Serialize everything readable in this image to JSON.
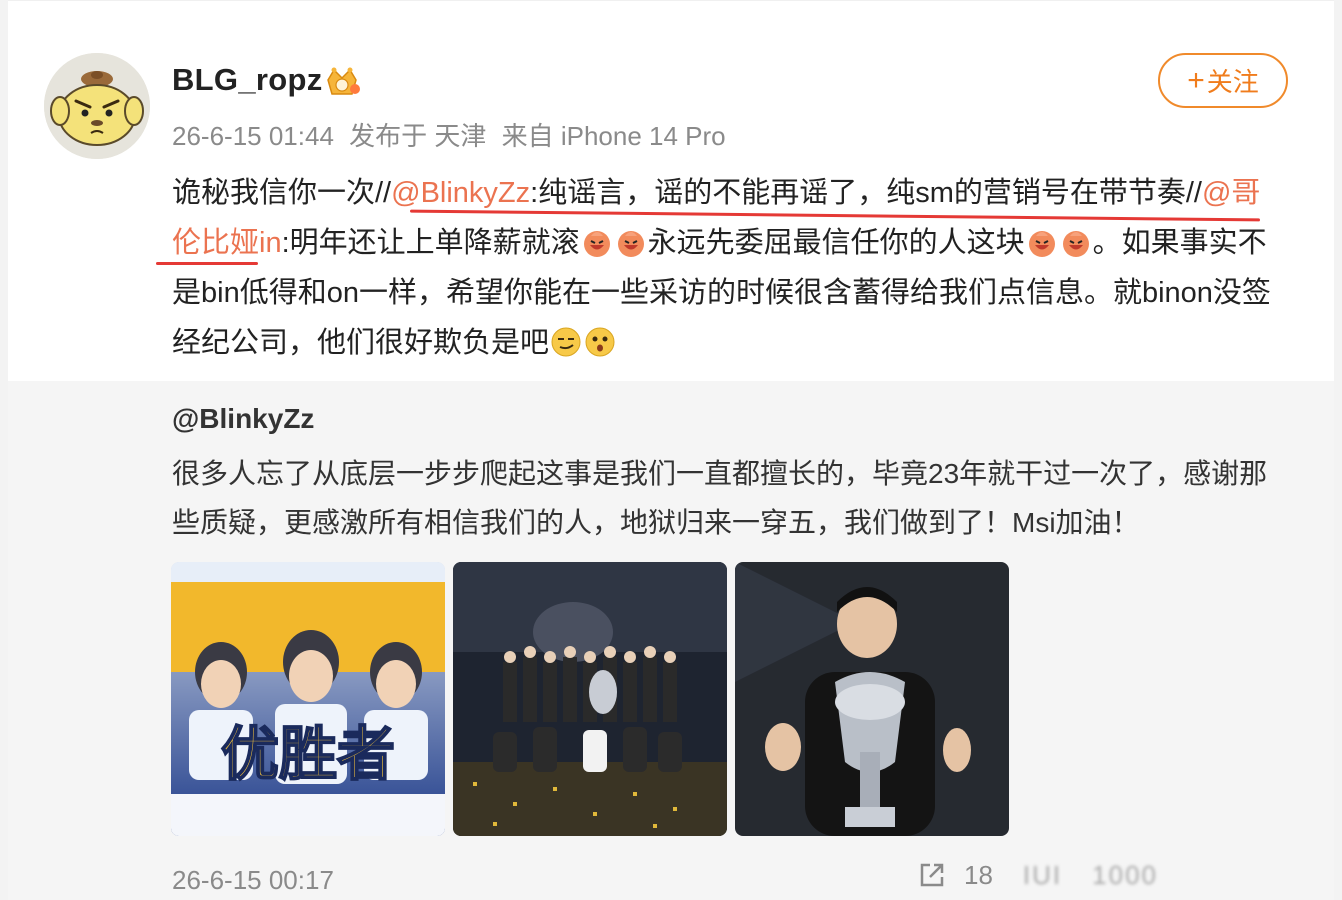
{
  "user": {
    "name": "BLG_ropz",
    "timestamp": "26-6-15 01:44",
    "location": "发布于 天津",
    "device": "来自 iPhone 14 Pro"
  },
  "follow": {
    "plus": "+",
    "label": "关注"
  },
  "post": {
    "p1": "诡秘我信你一次//",
    "m1": "@BlinkyZz",
    "p2": ":纯谣言，谣的不能再谣了，纯sm的营销号在带节奏//",
    "m2": "@哥伦比娅in",
    "p3": ":明年还让上单降薪就滚",
    "p4": "永远先委屈最信任你的人这块",
    "p5": "。如果事实不是bin低得和on一样，希望你能在一些采访的时候很含蓄得给我们点信息。就binon没签经纪公司，他们很好欺负是吧"
  },
  "repost": {
    "user": "@BlinkyZz",
    "text": "很多人忘了从底层一步步爬起这事是我们一直都擅长的，毕竟23年就干过一次了，感谢那些质疑，更感激所有相信我们的人，地狱归来一穿五，我们做到了！Msi加油！",
    "photo1_text": "优胜者",
    "time": "26-6-15 00:17",
    "share_count": "18",
    "comment_count": "IUI",
    "like_count": "1000"
  },
  "colors": {
    "accent": "#f07c1c",
    "mention": "#eb7350",
    "underline": "#e53935"
  }
}
